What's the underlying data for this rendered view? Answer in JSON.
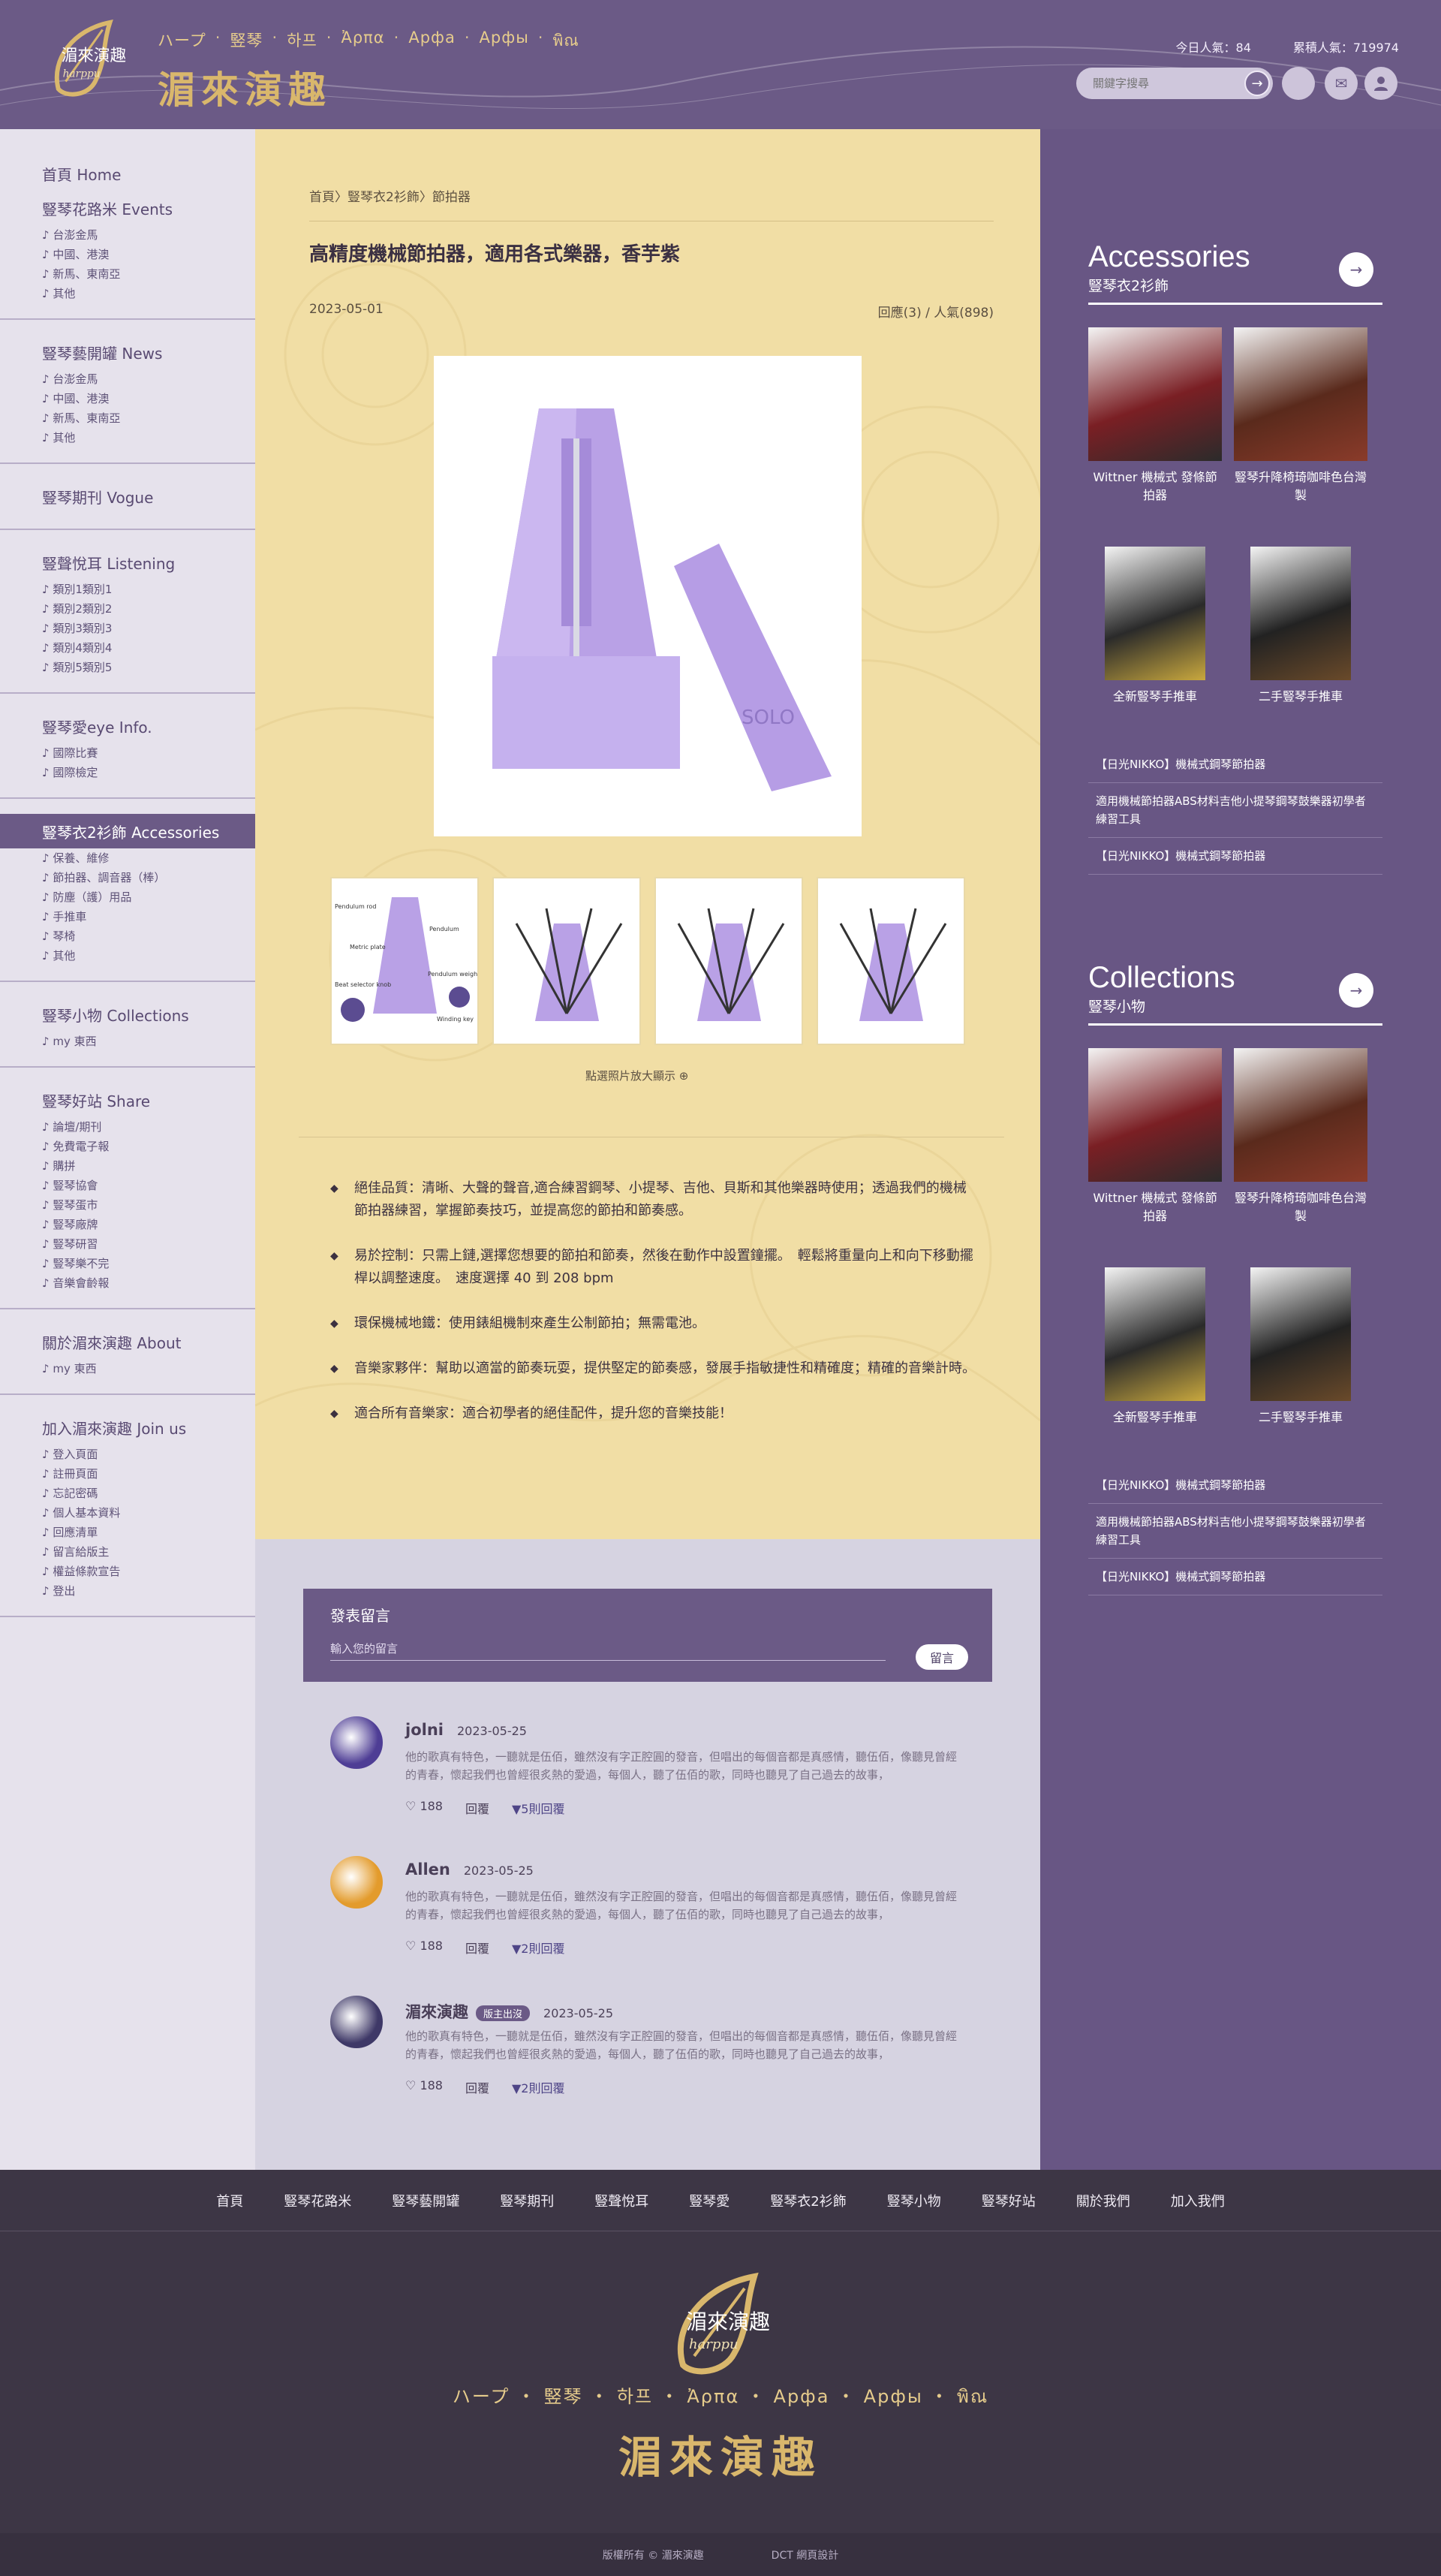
{
  "header": {
    "langs": [
      "ハープ",
      "竪琴",
      "하프",
      "Ἀρπα",
      "Арфа",
      "Арфы",
      "พิณ"
    ],
    "brand": "湄來演趣",
    "logo_text": "湄來演趣",
    "logo_sub": "harppu",
    "today_visits": "今日人氣：84",
    "total_visits": "累積人氣：719974",
    "search_placeholder": "關鍵字搜尋",
    "search_go": "→"
  },
  "sidebar": [
    {
      "title": "首頁 Home",
      "items": []
    },
    {
      "title": "豎琴花路米 Events",
      "items": [
        "台澎金馬",
        "中國、港澳",
        "新馬、東南亞",
        "其他"
      ]
    },
    {
      "title": "豎琴藝開罐 News",
      "items": [
        "台澎金馬",
        "中國、港澳",
        "新馬、東南亞",
        "其他"
      ]
    },
    {
      "title": "豎琴期刊 Vogue",
      "items": []
    },
    {
      "title": "豎聲悅耳 Listening",
      "items": [
        "類別1類別1",
        "類別2類別2",
        "類別3類別3",
        "類別4類別4",
        "類別5類別5"
      ]
    },
    {
      "title": "豎琴愛eye  Info.",
      "items": [
        "國際比賽",
        "國際檢定"
      ]
    },
    {
      "title": "豎琴衣2衫飾 Accessories",
      "items": [
        "保養、維修",
        "節拍器、調音器（棒）",
        "防塵（護）用品",
        "手推車",
        "琴椅",
        "其他"
      ]
    },
    {
      "title": "豎琴小物 Collections",
      "items": [
        "my 東西"
      ]
    },
    {
      "title": "豎琴好站 Share",
      "items": [
        "論壇/期刊",
        "免費電子報",
        "購拼",
        "豎琴協會",
        "豎琴蛋市",
        "豎琴廠牌",
        "豎琴研習",
        "豎琴樂不完",
        "音樂會齡報"
      ]
    },
    {
      "title": "關於湄來演趣 About",
      "items": [
        "my 東西"
      ]
    },
    {
      "title": "加入湄來演趣 Join us",
      "items": [
        "登入頁面",
        "註冊頁面",
        "忘記密碼",
        "個人基本資料",
        "回應清單",
        "留言給版主",
        "權益條款宣告",
        "登出"
      ]
    }
  ],
  "article": {
    "breadcrumb": "首頁〉豎琴衣2衫飾〉節拍器",
    "title": "高精度機械節拍器，適用各式樂器，香芋紫",
    "date": "2023-05-01",
    "meta": "回應(3) / 人氣(898)",
    "zoom_hint": "點選照片放大顯示",
    "product_label": "SOLO",
    "thumb_labels": [
      "Pendulum rod",
      "Pendulum",
      "Metric plate",
      "Beat selector knob",
      "Pendulum weight",
      "Winding key"
    ],
    "bullets": [
      "絕佳品質：清晰、大聲的聲音,適合練習鋼琴、小提琴、吉他、貝斯和其他樂器時使用；透過我們的機械節拍器練習，掌握節奏技巧，並提高您的節拍和節奏感。",
      "易於控制：只需上鏈,選擇您想要的節拍和節奏，然後在動作中設置鐘擺。　輕鬆將重量向上和向下移動擺桿以調整速度。　速度選擇 40 到 208 bpm",
      "環保機械地鐵：使用錶組機制來產生公制節拍；無需電池。",
      "音樂家夥伴：幫助以適當的節奏玩耍，提供堅定的節奏感，發展手指敏捷性和精確度；精確的音樂計時。",
      "適合所有音樂家：適合初學者的絕佳配件，提升您的音樂技能！"
    ]
  },
  "comments": {
    "form_label": "發表留言",
    "placeholder": "輸入您的留言",
    "submit": "留言",
    "list": [
      {
        "name": "jolni",
        "date": "2023-05-25",
        "badge": "",
        "text": "他的歌真有特色，一聽就是伍佰，雖然沒有字正腔圓的發音，但唱出的每個音都是真感情，聽伍佰，像聽見曾經的青春，懷起我們也曾經很炙熱的愛過，每個人，聽了伍佰的歌，同時也聽見了自己過去的故事，",
        "likes": "188",
        "reply": "回覆",
        "more": "▼5則回覆"
      },
      {
        "name": "Allen",
        "date": "2023-05-25",
        "badge": "",
        "text": "他的歌真有特色，一聽就是伍佰，雖然沒有字正腔圓的發音，但唱出的每個音都是真感情，聽伍佰，像聽見曾經的青春，懷起我們也曾經很炙熱的愛過，每個人，聽了伍佰的歌，同時也聽見了自己過去的故事，",
        "likes": "188",
        "reply": "回覆",
        "more": "▼2則回覆"
      },
      {
        "name": "湄來演趣",
        "date": "2023-05-25",
        "badge": "版主出沒",
        "text": "他的歌真有特色，一聽就是伍佰，雖然沒有字正腔圓的發音，但唱出的每個音都是真感情，聽伍佰，像聽見曾經的青春，懷起我們也曾經很炙熱的愛過，每個人，聽了伍佰的歌，同時也聽見了自己過去的故事，",
        "likes": "188",
        "reply": "回覆",
        "more": "▼2則回覆"
      }
    ]
  },
  "right": [
    {
      "title": "Accessories",
      "subtitle": "豎琴衣2衫飾",
      "arrow": "→",
      "products": [
        "Wittner 機械式 發條節拍器",
        "豎琴升降椅琦咖啡色台灣製",
        "全新豎琴手推車",
        "二手豎琴手推車"
      ],
      "links": [
        "【日光NIKKO】機械式鋼琴節拍器",
        "適用機械節拍器ABS材料吉他小提琴鋼琴鼓樂器初學者練習工具",
        "【日光NIKKO】機械式鋼琴節拍器"
      ]
    },
    {
      "title": "Collections",
      "subtitle": "豎琴小物",
      "arrow": "→",
      "products": [
        "Wittner 機械式 發條節拍器",
        "豎琴升降椅琦咖啡色台灣製",
        "全新豎琴手推車",
        "二手豎琴手推車"
      ],
      "links": [
        "【日光NIKKO】機械式鋼琴節拍器",
        "適用機械節拍器ABS材料吉他小提琴鋼琴鼓樂器初學者練習工具",
        "【日光NIKKO】機械式鋼琴節拍器"
      ]
    }
  ],
  "footer": {
    "nav": [
      "首頁",
      "豎琴花路米",
      "豎琴藝開罐",
      "豎琴期刊",
      "豎聲悅耳",
      "豎琴愛",
      "豎琴衣2衫飾",
      "豎琴小物",
      "豎琴好站",
      "關於我們",
      "加入我們"
    ],
    "langs": "ハープ ・ 竪琴 ・ 하프 ・ Ἀρπα ・ Арфа ・ Арфы ・ พิณ",
    "brand": "湄來演趣",
    "copyright": "版權所有 © 湄來演趣",
    "credit": "DCT 網頁設計"
  },
  "colors": {
    "purple": "#6b5a86",
    "gold": "#d9b76c",
    "cream": "#f1dea5",
    "lilac": "#b49ee0"
  }
}
